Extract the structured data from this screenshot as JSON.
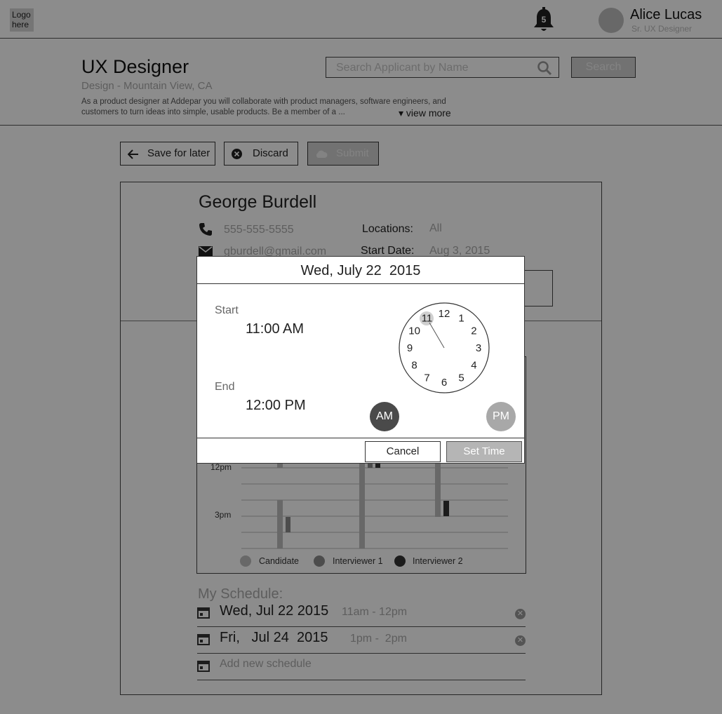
{
  "header": {
    "logo_text": "Logo here",
    "notifications_count": "5",
    "user_name": "Alice Lucas",
    "user_role": "Sr. UX Designer",
    "icons": {
      "bell": "bell-icon",
      "avatar": "avatar"
    }
  },
  "job": {
    "title": "UX Designer",
    "subtitle": "Design - Mountain View, CA",
    "description": "As a product designer at Addepar you will collaborate with product managers, software engineers, and customers to turn ideas into simple, usable products. Be a member of a ...",
    "view_more": "▾ view more"
  },
  "search": {
    "placeholder": "Search Applicant by Name",
    "button_label": "Search"
  },
  "toolbar": {
    "save_label": "Save for later",
    "discard_label": "Discard",
    "submit_label": "Submit"
  },
  "candidate": {
    "name": "George Burdell",
    "phone": "555-555-5555",
    "email": "gburdell@gmail.com",
    "locations_label": "Locations:",
    "locations_value": "All",
    "start_date_label": "Start Date:",
    "start_date_value": "Aug 3, 2015"
  },
  "availability_chart": {
    "tick_labels": [
      "12pm",
      "3pm"
    ],
    "legend": [
      {
        "label": "Candidate",
        "color": "#bdbdbd"
      },
      {
        "label": "Interviewer 1",
        "color": "#8a8a8a"
      },
      {
        "label": "Interviewer 2",
        "color": "#333333"
      }
    ]
  },
  "schedule": {
    "title": "My Schedule:",
    "items": [
      {
        "date": "Wed, Jul 22  2015",
        "time": "11am - 12pm"
      },
      {
        "date": "Fri,   Jul 24  2015",
        "time": "1pm -  2pm"
      }
    ],
    "add_label": "Add new schedule"
  },
  "time_picker": {
    "date_title": "Wed, July 22  2015",
    "start_label": "Start",
    "start_time": "11:00 AM",
    "end_label": "End",
    "end_time": "12:00 PM",
    "clock_numbers": [
      "12",
      "1",
      "2",
      "3",
      "4",
      "5",
      "6",
      "7",
      "8",
      "9",
      "10",
      "11"
    ],
    "selected_hour": "11",
    "am_label": "AM",
    "pm_label": "PM",
    "cancel_label": "Cancel",
    "set_label": "Set Time"
  }
}
